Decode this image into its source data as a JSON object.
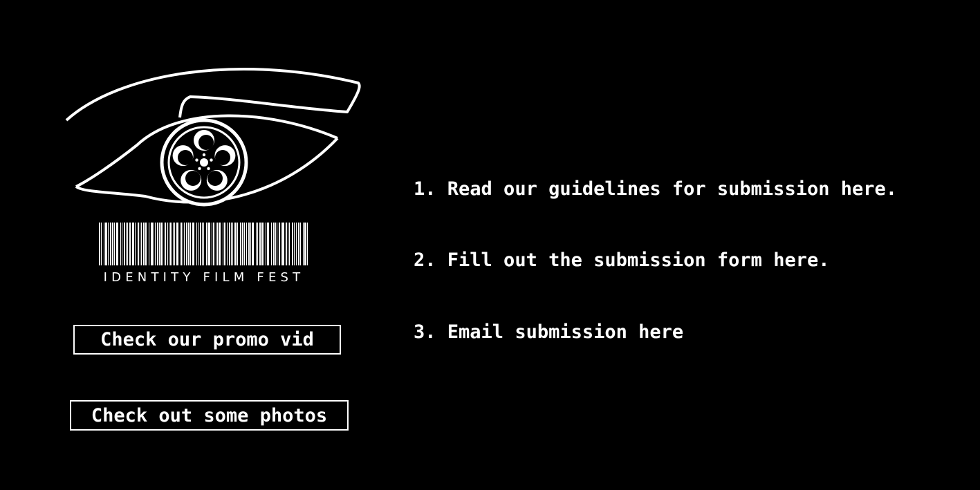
{
  "logo": {
    "wordmark": "IDENTITY FILM FEST",
    "icon": "eye-with-film-reel-logo"
  },
  "buttons": {
    "promo_label": "Check our promo vid",
    "photos_label": "Check out some photos"
  },
  "steps": [
    {
      "number": "1.",
      "text": "Read our guidelines for submission ",
      "link": "here",
      "suffix": "."
    },
    {
      "number": "2.",
      "text": "Fill out the submission form ",
      "link": "here",
      "suffix": "."
    },
    {
      "number": "3.",
      "text": "Email submission ",
      "link": "here",
      "suffix": ""
    }
  ],
  "colors": {
    "background": "#000000",
    "foreground": "#ffffff"
  }
}
